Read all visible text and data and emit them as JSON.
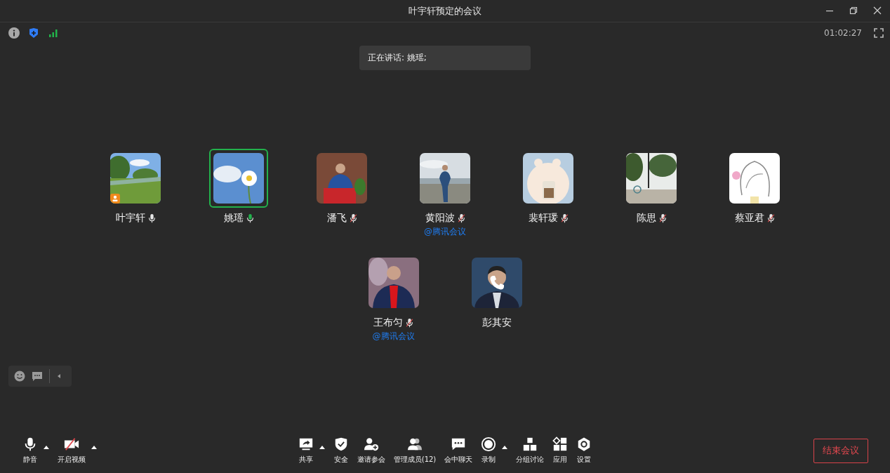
{
  "window": {
    "title": "叶宇轩预定的会议"
  },
  "status_bar": {
    "timer": "01:02:27"
  },
  "speaking_banner": {
    "text": "正在讲话: 姚瑶;"
  },
  "participants": [
    {
      "name": "叶宇轩",
      "kind": "unmuted",
      "speaking": false,
      "host": true
    },
    {
      "name": "姚瑶",
      "kind": "unmuted",
      "speaking": true,
      "host": false
    },
    {
      "name": "潘飞",
      "kind": "muted",
      "speaking": false,
      "host": false
    },
    {
      "name": "黄阳波",
      "kind": "muted",
      "speaking": false,
      "host": false,
      "tag": "@腾讯会议"
    },
    {
      "name": "裴轩瑗",
      "kind": "muted",
      "speaking": false,
      "host": false
    },
    {
      "name": "陈思",
      "kind": "muted",
      "speaking": false,
      "host": false
    },
    {
      "name": "蔡亚君",
      "kind": "muted",
      "speaking": false,
      "host": false
    },
    {
      "name": "王布匀",
      "kind": "muted",
      "speaking": false,
      "host": false,
      "tag": "@腾讯会议"
    },
    {
      "name": "彭其安",
      "kind": "phone",
      "speaking": false,
      "host": false
    }
  ],
  "toolbar": {
    "left": [
      {
        "label": "静音",
        "kind": "mic",
        "has_menu": true
      },
      {
        "label": "开启视频",
        "kind": "camera",
        "has_menu": true
      }
    ],
    "center": [
      {
        "label": "共享",
        "kind": "share",
        "has_menu": true
      },
      {
        "label": "安全",
        "kind": "security",
        "has_menu": false
      },
      {
        "label": "邀请参会",
        "kind": "invite",
        "has_menu": false
      },
      {
        "label": "管理成员(12)",
        "kind": "members",
        "has_menu": false
      },
      {
        "label": "会中聊天",
        "kind": "chat",
        "has_menu": false
      },
      {
        "label": "录制",
        "kind": "record",
        "has_menu": true
      },
      {
        "label": "分组讨论",
        "kind": "breakout",
        "has_menu": false
      },
      {
        "label": "应用",
        "kind": "apps",
        "has_menu": false
      },
      {
        "label": "设置",
        "kind": "settings",
        "has_menu": false
      }
    ],
    "end_button": "结束会议"
  }
}
